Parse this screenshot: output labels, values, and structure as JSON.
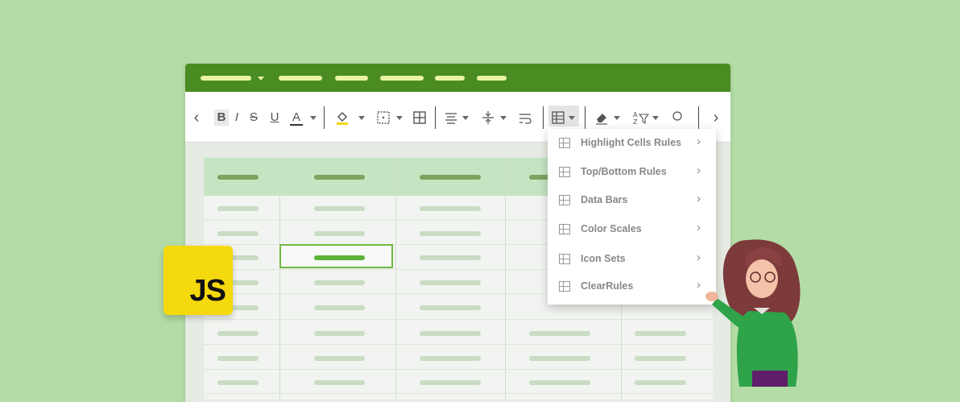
{
  "toolbar": {
    "prev_label": "‹",
    "next_label": "›",
    "bold": "B",
    "italic": "I",
    "strike": "S",
    "underline": "U",
    "font_color": "A"
  },
  "menu": {
    "items": [
      {
        "label": "Highlight Cells Rules",
        "icon": "highlight-cells-icon"
      },
      {
        "label": "Top/Bottom Rules",
        "icon": "top-bottom-icon"
      },
      {
        "label": "Data Bars",
        "icon": "data-bars-icon"
      },
      {
        "label": "Color Scales",
        "icon": "color-scales-icon"
      },
      {
        "label": "Icon Sets",
        "icon": "icon-sets-icon"
      },
      {
        "label": "ClearRules",
        "icon": "clear-rules-icon"
      }
    ],
    "chevron": "›"
  },
  "badge": {
    "text": "JS"
  },
  "colors": {
    "background": "#b3dca6",
    "ribbon": "#4a8c22",
    "header_row": "#c5e5c2",
    "selection": "#71b743",
    "badge": "#f5d90f"
  }
}
